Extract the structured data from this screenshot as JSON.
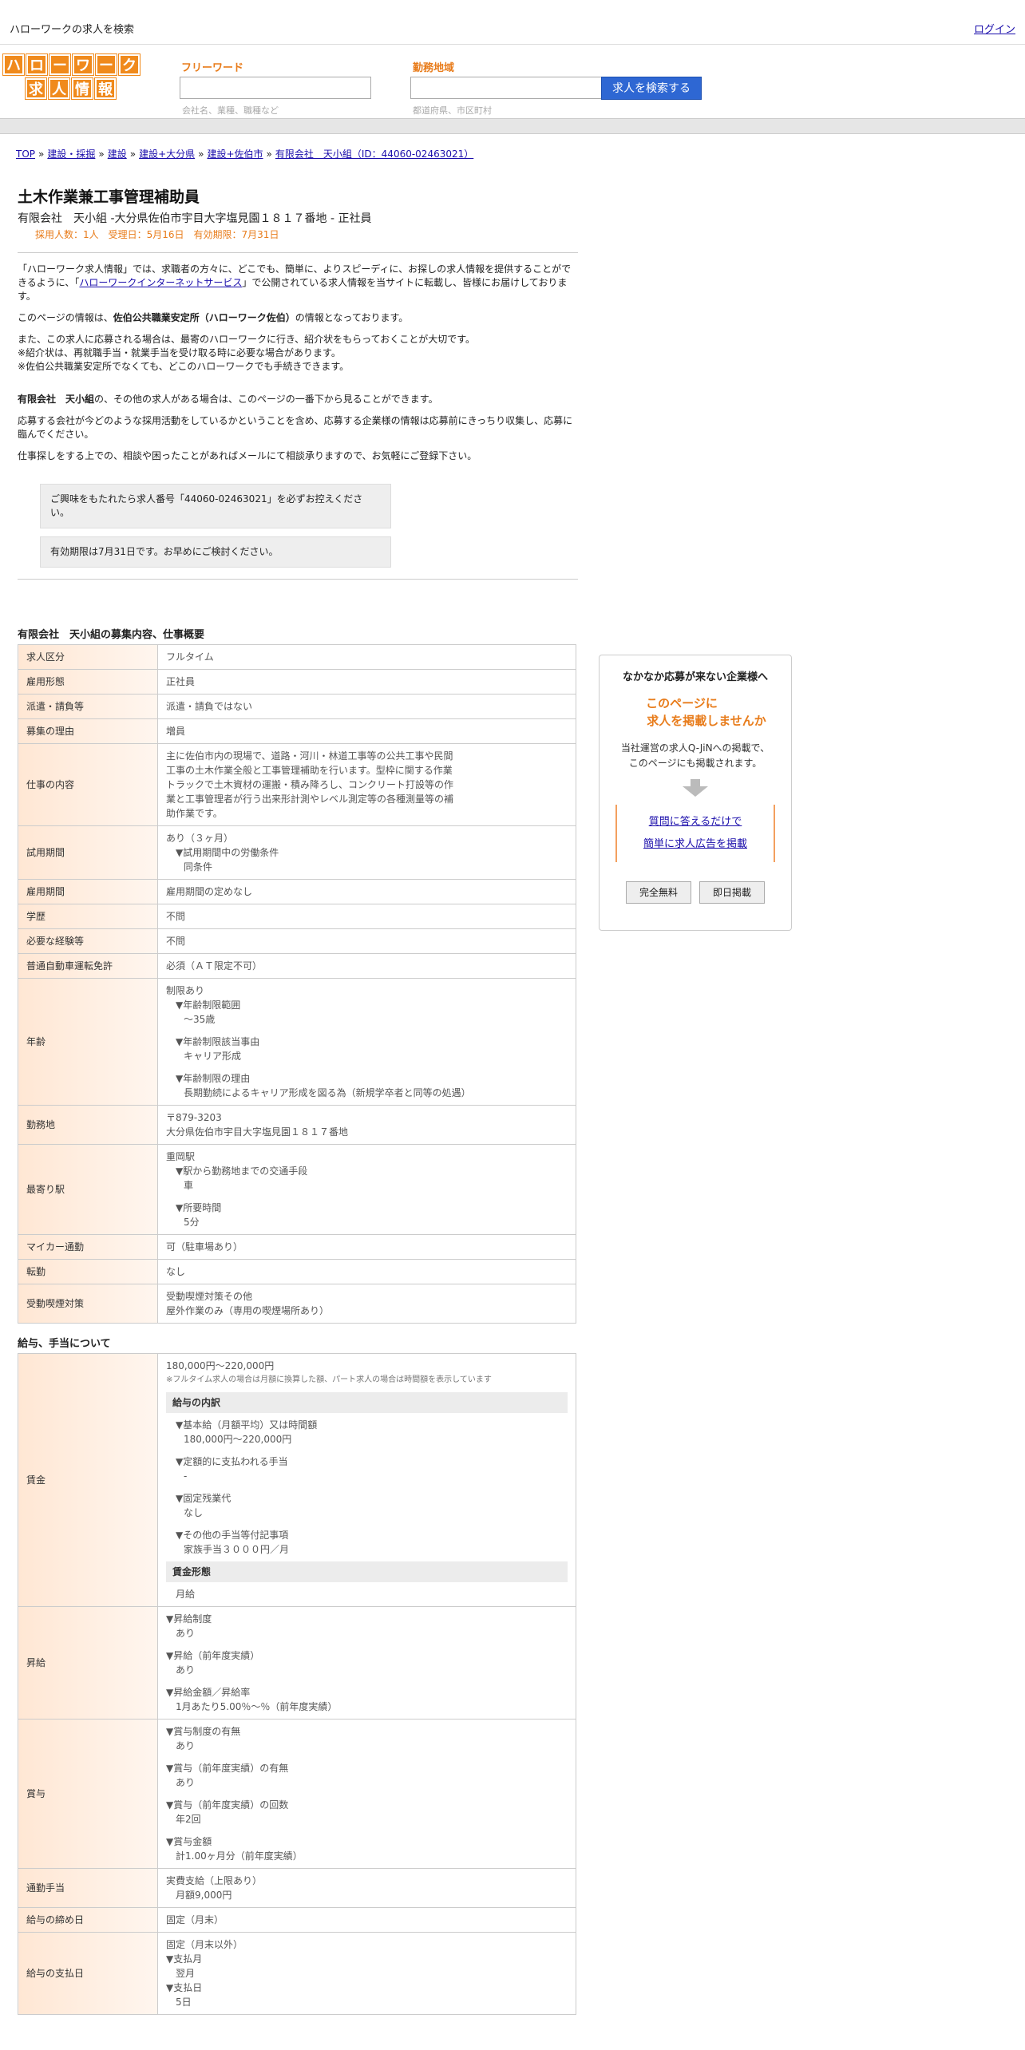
{
  "topbar": {
    "site_link": "ハローワークの求人を検索",
    "login": "ログイン"
  },
  "logo": {
    "row1": [
      "ハ",
      "ロ",
      "ー",
      "ワ",
      "ー",
      "ク"
    ],
    "row2": [
      "求",
      "人",
      "情",
      "報"
    ]
  },
  "search": {
    "freeword_label": "フリーワード",
    "freeword_hint": "会社名、業種、職種など",
    "area_label": "勤務地域",
    "area_hint": "都道府県、市区町村",
    "button": "求人を検索する"
  },
  "breadcrumb": [
    "TOP",
    "建設・採掘",
    "建設",
    "建設+大分県",
    "建設+佐伯市",
    "有限会社　天小組（ID：44060-02463021）"
  ],
  "job": {
    "title": "土木作業兼工事管理補助員",
    "subtitle": "有限会社　天小組 -大分県佐伯市宇目大字塩見園１８１７番地 - 正社員",
    "meta": "採用人数：1人　受理日：5月16日　有効期限：7月31日"
  },
  "intro": {
    "p1_a": "「ハローワーク求人情報」では、求職者の方々に、どこでも、簡単に、よりスピーディに、お探しの求人情報を提供することができるように、「",
    "p1_link": "ハローワークインターネットサービス",
    "p1_b": "」で公開されている求人情報を当サイトに転載し、皆様にお届けしております。",
    "p2_a": "このページの情報は、",
    "p2_bold": "佐伯公共職業安定所（ハローワーク佐伯）",
    "p2_b": "の情報となっております。",
    "p3_l1": "また、この求人に応募される場合は、最寄のハローワークに行き、紹介状をもらっておくことが大切です。",
    "p3_l2": "※紹介状は、再就職手当・就業手当を受け取る時に必要な場合があります。",
    "p3_l3": "※佐伯公共職業安定所でなくても、どこのハローワークでも手続きできます。",
    "p4_bold": "有限会社　天小組",
    "p4_rest": "の、その他の求人がある場合は、このページの一番下から見ることができます。",
    "p5": "応募する会社が今どのような採用活動をしているかということを含め、応募する企業様の情報は応募前にきっちり収集し、応募に臨んでください。",
    "p6": "仕事探しをする上での、相談や困ったことがあればメールにて相談承りますので、お気軽にご登録下さい。",
    "notice1": "ご興味をもたれたら求人番号「44060-02463021」を必ずお控えください。",
    "notice2": "有効期限は7月31日です。お早めにご検討ください。"
  },
  "overview": {
    "title": "有限会社　天小組の募集内容、仕事概要",
    "rows": [
      {
        "k": "求人区分",
        "v": [
          "フルタイム"
        ]
      },
      {
        "k": "雇用形態",
        "v": [
          "正社員"
        ]
      },
      {
        "k": "派遣・請負等",
        "v": [
          "派遣・請負ではない"
        ]
      },
      {
        "k": "募集の理由",
        "v": [
          "増員"
        ]
      },
      {
        "k": "仕事の内容",
        "v": [
          "主に佐伯市内の現場で、道路・河川・林道工事等の公共工事や民間",
          "工事の土木作業全般と工事管理補助を行います。型枠に関する作業",
          "トラックで土木資材の運搬・積み降ろし、コンクリート打設等の作",
          "業と工事管理者が行う出来形計測やレベル測定等の各種測量等の補",
          "助作業です。"
        ]
      },
      {
        "k": "試用期間",
        "v": [
          "あり（３ヶ月）",
          "▼試用期間中の労働条件",
          "同条件"
        ]
      },
      {
        "k": "雇用期間",
        "v": [
          "雇用期間の定めなし"
        ]
      },
      {
        "k": "学歴",
        "v": [
          "不問"
        ]
      },
      {
        "k": "必要な経験等",
        "v": [
          "不問"
        ]
      },
      {
        "k": "普通自動車運転免許",
        "v": [
          "必須（ＡＴ限定不可）"
        ]
      },
      {
        "k": "年齢",
        "v": [
          "制限あり",
          "▼年齢制限範囲",
          "〜35歳",
          "▼年齢制限該当事由",
          "キャリア形成",
          "▼年齢制限の理由",
          "長期勤続によるキャリア形成を図る為（新規学卒者と同等の処遇）"
        ]
      },
      {
        "k": "勤務地",
        "v": [
          "〒879-3203",
          "大分県佐伯市宇目大字塩見園１８１７番地"
        ]
      },
      {
        "k": "最寄り駅",
        "v": [
          "重岡駅",
          "▼駅から勤務地までの交通手段",
          "車",
          "▼所要時間",
          "5分"
        ]
      },
      {
        "k": "マイカー通勤",
        "v": [
          "可（駐車場あり）"
        ]
      },
      {
        "k": "転勤",
        "v": [
          "なし"
        ]
      },
      {
        "k": "受動喫煙対策",
        "v": [
          "受動喫煙対策その他",
          "屋外作業のみ（専用の喫煙場所あり）"
        ]
      }
    ]
  },
  "salary": {
    "title": "給与、手当について",
    "wage_key": "賃金",
    "wage_amount": "180,000円〜220,000円",
    "wage_note": "※フルタイム求人の場合は月額に換算した額、パート求人の場合は時間額を表示しています",
    "breakdown_head": "給与の内訳",
    "breakdown": [
      "▼基本給（月額平均）又は時間額",
      "180,000円〜220,000円",
      "▼定額的に支払われる手当",
      "-",
      "▼固定残業代",
      "なし",
      "▼その他の手当等付記事項",
      "家族手当３０００円／月"
    ],
    "form_head": "賃金形態",
    "form": "月給",
    "raise_key": "昇給",
    "raise": [
      "▼昇給制度",
      "あり",
      "▼昇給（前年度実績）",
      "あり",
      "▼昇給金額／昇給率",
      "1月あたり5.00％〜％（前年度実績）"
    ],
    "bonus_key": "賞与",
    "bonus": [
      "▼賞与制度の有無",
      "あり",
      "▼賞与（前年度実績）の有無",
      "あり",
      "▼賞与（前年度実績）の回数",
      "年2回",
      "▼賞与金額",
      "計1.00ヶ月分（前年度実績）"
    ],
    "commute_key": "通勤手当",
    "commute": [
      "実費支給（上限あり）",
      "月額9,000円"
    ],
    "closing_key": "給与の締め日",
    "closing": "固定（月末）",
    "payday_key": "給与の支払日",
    "payday": [
      "固定（月末以外）",
      "▼支払月",
      "翌月",
      "▼支払日",
      "5日"
    ]
  },
  "side": {
    "title": "なかなか応募が来ない企業様へ",
    "lead1": "このページに",
    "lead2": "求人を掲載しませんか",
    "text1": "当社運営の求人Q-JiNへの掲載で、",
    "text2": "このページにも掲載されます。",
    "link1": "質問に答えるだけで",
    "link2": "簡単に求人広告を掲載",
    "btn1": "完全無料",
    "btn2": "即日掲載"
  }
}
